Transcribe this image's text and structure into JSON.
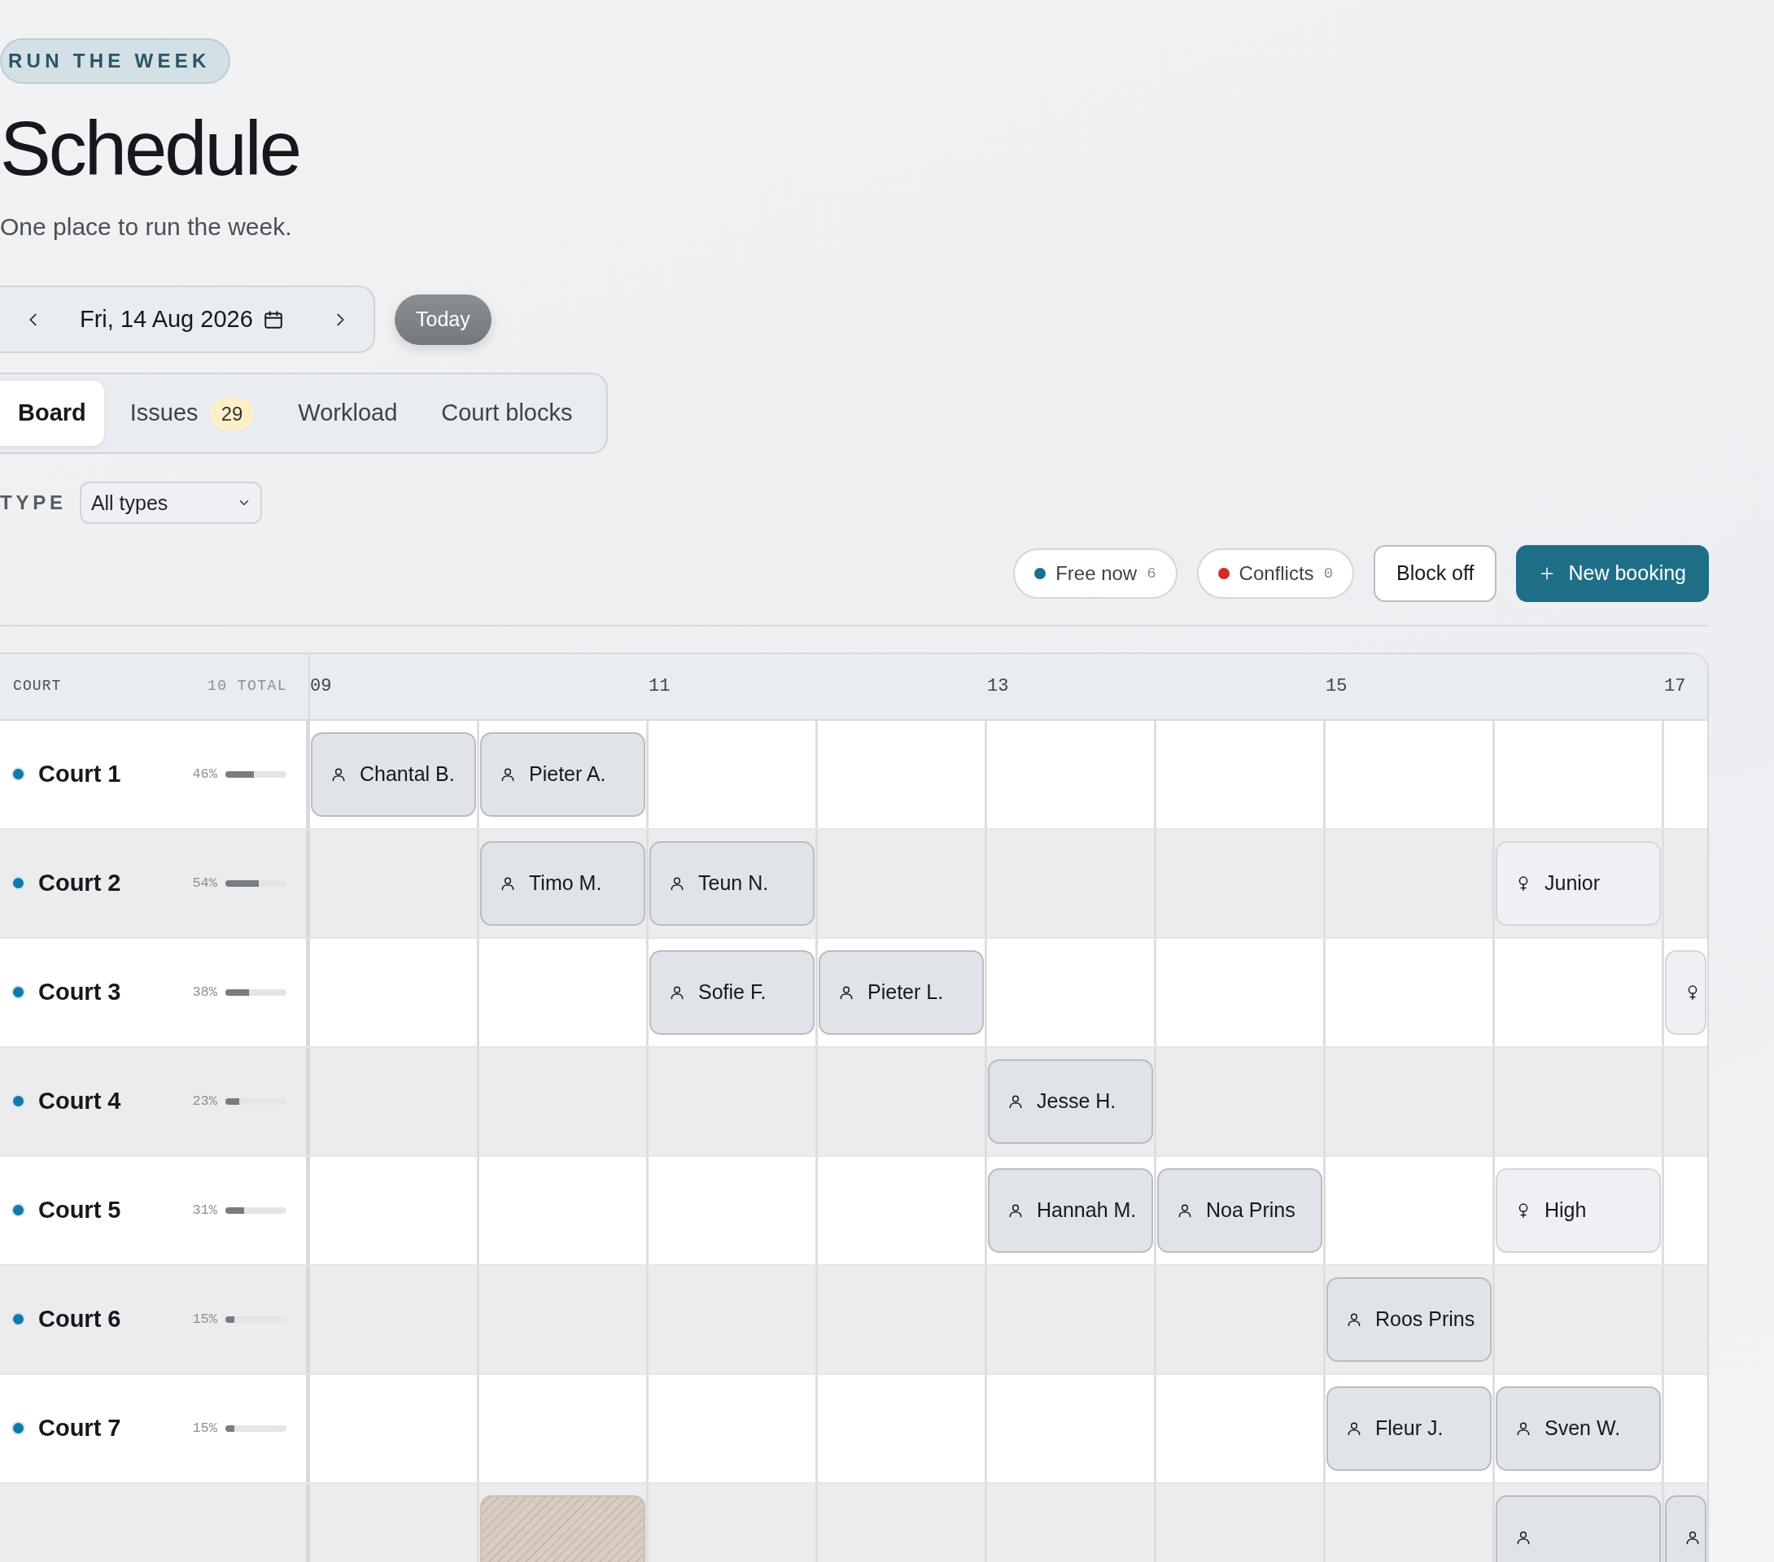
{
  "eyebrow": "RUN THE WEEK",
  "title": "Schedule",
  "subtitle": "One place to run the week.",
  "date_nav": {
    "date": "Fri, 14 Aug 2026"
  },
  "today_button": "Today",
  "tabs": [
    {
      "label": "Board",
      "selected": true
    },
    {
      "label": "Issues",
      "badge": "29",
      "selected": false
    },
    {
      "label": "Workload",
      "selected": false
    },
    {
      "label": "Court blocks",
      "selected": false
    }
  ],
  "filter": {
    "label": "TYPE",
    "value": "All types"
  },
  "chips": [
    {
      "label": "Free now",
      "count": "6",
      "color": "#1f6f8b"
    },
    {
      "label": "Conflicts",
      "count": "0",
      "color": "#d42a2a"
    }
  ],
  "actions": [
    {
      "label": "Block off",
      "kind": "secondary"
    },
    {
      "label": "New booking",
      "kind": "primary"
    }
  ],
  "board": {
    "court_header": "COURT",
    "total": "10 TOTAL",
    "hours": [
      "09",
      "11",
      "13",
      "15",
      "17"
    ],
    "rows": [
      {
        "court": "Court 1",
        "utilization": "46%",
        "level": 0.46,
        "slots": [
          {
            "kind": "booking",
            "label": "Chantal B."
          },
          {
            "kind": "booking",
            "label": "Pieter A."
          },
          {
            "kind": "empty"
          },
          {
            "kind": "empty"
          },
          {
            "kind": "empty"
          },
          {
            "kind": "empty"
          },
          {
            "kind": "empty"
          },
          {
            "kind": "empty"
          },
          {
            "kind": "empty"
          }
        ]
      },
      {
        "court": "Court 2",
        "utilization": "54%",
        "level": 0.54,
        "slots": [
          {
            "kind": "empty"
          },
          {
            "kind": "booking",
            "label": "Timo M."
          },
          {
            "kind": "booking",
            "label": "Teun N."
          },
          {
            "kind": "empty"
          },
          {
            "kind": "empty"
          },
          {
            "kind": "empty"
          },
          {
            "kind": "empty"
          },
          {
            "kind": "class",
            "label": "Junior"
          },
          {
            "kind": "empty"
          }
        ]
      },
      {
        "court": "Court 3",
        "utilization": "38%",
        "level": 0.38,
        "slots": [
          {
            "kind": "empty"
          },
          {
            "kind": "empty"
          },
          {
            "kind": "booking",
            "label": "Sofie F."
          },
          {
            "kind": "booking",
            "label": "Pieter L."
          },
          {
            "kind": "empty"
          },
          {
            "kind": "empty"
          },
          {
            "kind": "empty"
          },
          {
            "kind": "empty"
          },
          {
            "kind": "class"
          }
        ]
      },
      {
        "court": "Court 4",
        "utilization": "23%",
        "level": 0.23,
        "slots": [
          {
            "kind": "empty"
          },
          {
            "kind": "empty"
          },
          {
            "kind": "empty"
          },
          {
            "kind": "empty"
          },
          {
            "kind": "booking",
            "label": "Jesse H."
          },
          {
            "kind": "empty"
          },
          {
            "kind": "empty"
          },
          {
            "kind": "empty"
          },
          {
            "kind": "empty"
          }
        ]
      },
      {
        "court": "Court 5",
        "utilization": "31%",
        "level": 0.31,
        "slots": [
          {
            "kind": "empty"
          },
          {
            "kind": "empty"
          },
          {
            "kind": "empty"
          },
          {
            "kind": "empty"
          },
          {
            "kind": "booking",
            "label": "Hannah M."
          },
          {
            "kind": "booking",
            "label": "Noa Prins"
          },
          {
            "kind": "empty"
          },
          {
            "kind": "class",
            "label": "High"
          },
          {
            "kind": "empty"
          }
        ]
      },
      {
        "court": "Court 6",
        "utilization": "15%",
        "level": 0.15,
        "slots": [
          {
            "kind": "empty"
          },
          {
            "kind": "empty"
          },
          {
            "kind": "empty"
          },
          {
            "kind": "empty"
          },
          {
            "kind": "empty"
          },
          {
            "kind": "empty"
          },
          {
            "kind": "booking",
            "label": "Roos Prins"
          },
          {
            "kind": "empty"
          },
          {
            "kind": "empty"
          }
        ]
      },
      {
        "court": "Court 7",
        "utilization": "15%",
        "level": 0.15,
        "slots": [
          {
            "kind": "empty"
          },
          {
            "kind": "empty"
          },
          {
            "kind": "empty"
          },
          {
            "kind": "empty"
          },
          {
            "kind": "empty"
          },
          {
            "kind": "empty"
          },
          {
            "kind": "booking",
            "label": "Fleur J."
          },
          {
            "kind": "booking",
            "label": "Sven W."
          },
          {
            "kind": "empty"
          }
        ]
      },
      {
        "slots": [
          {
            "kind": "empty"
          },
          {
            "kind": "blocked"
          },
          {
            "kind": "empty"
          },
          {
            "kind": "empty"
          },
          {
            "kind": "empty"
          },
          {
            "kind": "empty"
          },
          {
            "kind": "empty"
          },
          {
            "kind": "booking"
          },
          {
            "kind": "booking"
          }
        ]
      }
    ]
  }
}
